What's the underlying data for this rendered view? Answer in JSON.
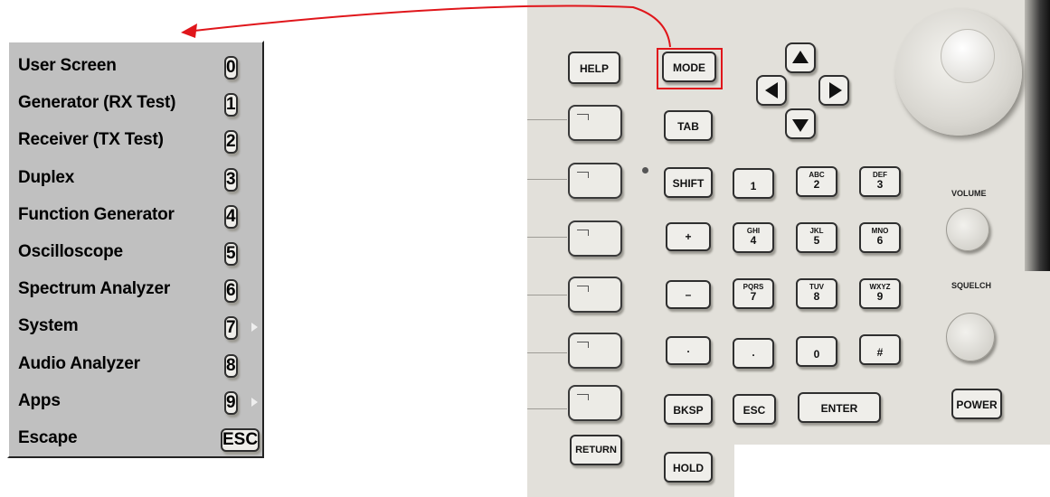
{
  "menu": {
    "items": [
      {
        "label": "User Screen",
        "key": "0",
        "submenu": false
      },
      {
        "label": "Generator (RX Test)",
        "key": "1",
        "submenu": false
      },
      {
        "label": "Receiver (TX Test)",
        "key": "2",
        "submenu": false
      },
      {
        "label": "Duplex",
        "key": "3",
        "submenu": false
      },
      {
        "label": "Function Generator",
        "key": "4",
        "submenu": false
      },
      {
        "label": "Oscilloscope",
        "key": "5",
        "submenu": false
      },
      {
        "label": "Spectrum Analyzer",
        "key": "6",
        "submenu": false
      },
      {
        "label": "System",
        "key": "7",
        "submenu": true
      },
      {
        "label": "Audio Analyzer",
        "key": "8",
        "submenu": false
      },
      {
        "label": "Apps",
        "key": "9",
        "submenu": true
      },
      {
        "label": "Escape",
        "key": "ESC",
        "submenu": false
      }
    ]
  },
  "panel": {
    "help": "HELP",
    "mode": "MODE",
    "tab": "TAB",
    "shift": "SHIFT",
    "plus": "+",
    "minus": "–",
    "dot_left": ".",
    "bksp": "BKSP",
    "esc": "ESC",
    "enter": "ENTER",
    "return": "RETURN",
    "hold": "HOLD",
    "power": "POWER",
    "volume": "VOLUME",
    "squelch": "SQUELCH",
    "numpad": {
      "k1": {
        "sub": "",
        "num": "1"
      },
      "k2": {
        "sub": "ABC",
        "num": "2"
      },
      "k3": {
        "sub": "DEF",
        "num": "3"
      },
      "k4": {
        "sub": "GHI",
        "num": "4"
      },
      "k5": {
        "sub": "JKL",
        "num": "5"
      },
      "k6": {
        "sub": "MNO",
        "num": "6"
      },
      "k7": {
        "sub": "PQRS",
        "num": "7"
      },
      "k8": {
        "sub": "TUV",
        "num": "8"
      },
      "k9": {
        "sub": "WXYZ",
        "num": "9"
      },
      "kdot": ".",
      "k0": "0",
      "khash": "#"
    }
  },
  "colors": {
    "menu_bg": "#c0c0c0",
    "panel_bg": "#e2e0da",
    "highlight": "#e0161b"
  }
}
